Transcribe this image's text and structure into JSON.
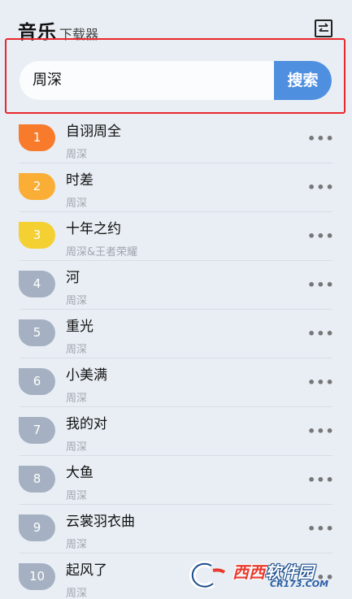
{
  "header": {
    "title": "音乐",
    "subtitle": "下载器",
    "swap_icon": "swap-arrows-icon"
  },
  "search": {
    "value": "周深",
    "button_label": "搜索"
  },
  "songs": [
    {
      "rank": "1",
      "title": "自诩周全",
      "artist": "周深",
      "more": "•••"
    },
    {
      "rank": "2",
      "title": "时差",
      "artist": "周深",
      "more": "•••"
    },
    {
      "rank": "3",
      "title": "十年之约",
      "artist": "周深&王者荣耀",
      "more": "•••"
    },
    {
      "rank": "4",
      "title": "河",
      "artist": "周深",
      "more": "•••"
    },
    {
      "rank": "5",
      "title": "重光",
      "artist": "周深",
      "more": "•••"
    },
    {
      "rank": "6",
      "title": "小美满",
      "artist": "周深",
      "more": "•••"
    },
    {
      "rank": "7",
      "title": "我的对",
      "artist": "周深",
      "more": "•••"
    },
    {
      "rank": "8",
      "title": "大鱼",
      "artist": "周深",
      "more": "•••"
    },
    {
      "rank": "9",
      "title": "云裳羽衣曲",
      "artist": "周深",
      "more": "•••"
    },
    {
      "rank": "10",
      "title": "起风了",
      "artist": "周深",
      "more": "•••"
    }
  ],
  "watermark": {
    "main_a": "西西",
    "main_b": "软件园",
    "sub": "CR173.COM"
  },
  "colors": {
    "background": "#e8eef4",
    "accent": "#4f8fe0",
    "highlight_border": "#e8282c",
    "rank1": "#f87a2b",
    "rank2": "#fbae35",
    "rank3": "#f5d032",
    "rank_other": "#a5b1c2"
  }
}
